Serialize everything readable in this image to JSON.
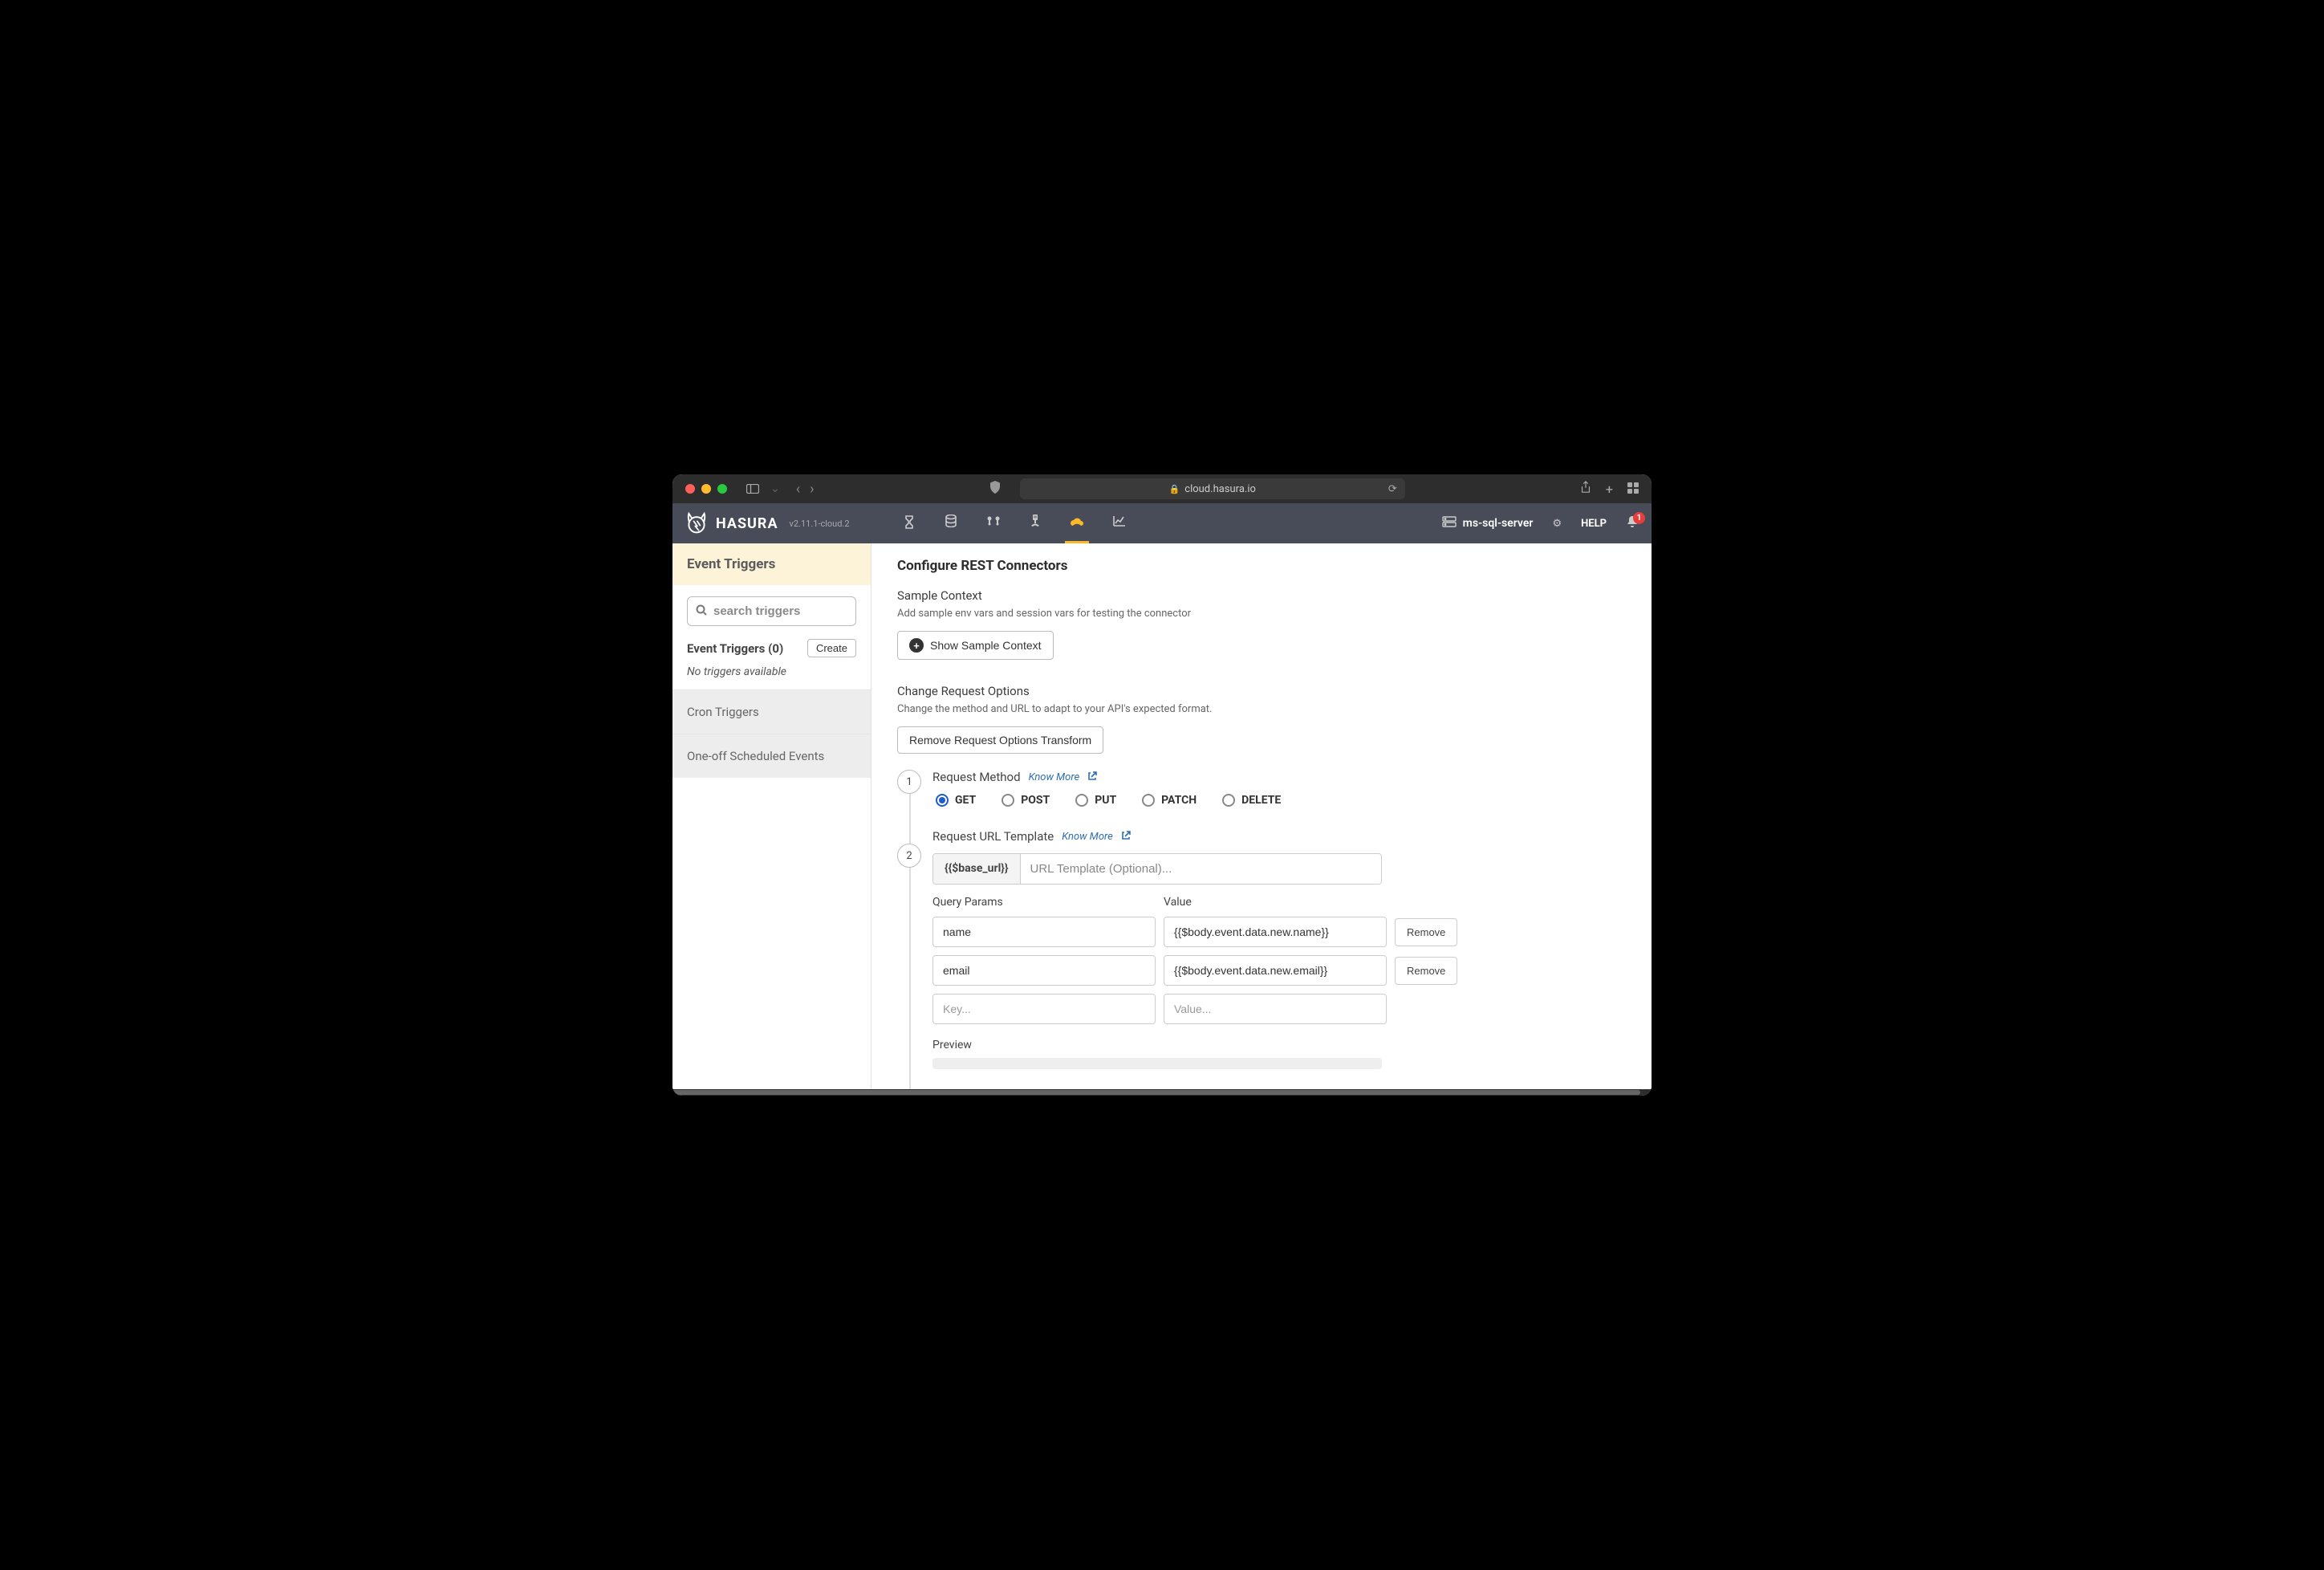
{
  "browser": {
    "url": "cloud.hasura.io"
  },
  "app": {
    "brand": "HASURA",
    "version": "v2.11.1-cloud.2",
    "db_label": "ms-sql-server",
    "help_label": "HELP",
    "notification_count": "1"
  },
  "sidebar": {
    "header": "Event Triggers",
    "search_placeholder": "search triggers",
    "list_title": "Event Triggers (0)",
    "create_label": "Create",
    "empty_text": "No triggers available",
    "items": [
      "Cron Triggers",
      "One-off Scheduled Events"
    ]
  },
  "main": {
    "title": "Configure REST Connectors",
    "sample_context": {
      "title": "Sample Context",
      "desc": "Add sample env vars and session vars for testing the connector",
      "button": "Show Sample Context"
    },
    "change_request": {
      "title": "Change Request Options",
      "desc": "Change the method and URL to adapt to your API's expected format.",
      "button": "Remove Request Options Transform"
    },
    "step1": {
      "num": "1",
      "label": "Request Method",
      "know_more": "Know More",
      "methods": [
        "GET",
        "POST",
        "PUT",
        "PATCH",
        "DELETE"
      ],
      "selected": "GET"
    },
    "step2": {
      "num": "2",
      "label": "Request URL Template",
      "know_more": "Know More",
      "prefix": "{{$base_url}}",
      "placeholder": "URL Template (Optional)...",
      "query_params_label": "Query Params",
      "value_label": "Value",
      "params": [
        {
          "key": "name",
          "value": "{{$body.event.data.new.name}}"
        },
        {
          "key": "email",
          "value": "{{$body.event.data.new.email}}"
        }
      ],
      "key_placeholder": "Key...",
      "value_placeholder": "Value...",
      "remove_label": "Remove",
      "preview_label": "Preview"
    }
  }
}
